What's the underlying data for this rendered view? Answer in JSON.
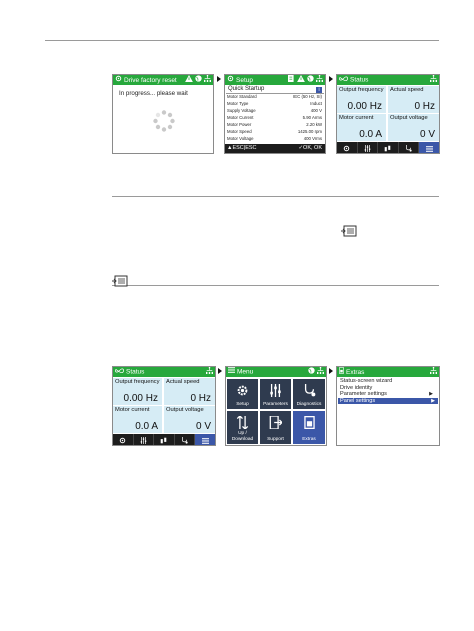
{
  "colors": {
    "title_green": "#27a83c",
    "status_cell": "#d6ecf5",
    "highlight_blue": "#3b57a8",
    "tile_dark": "#2f3b4f",
    "bar_black": "#1d1d1d"
  },
  "screen_factory_reset": {
    "title": "Drive factory reset",
    "title_icons": [
      "gear-icon",
      "warning-icon",
      "globe-icon",
      "network-icon"
    ],
    "message": "In progress... please wait",
    "spinner_icon": "spinner-icon"
  },
  "screen_setup": {
    "title": "Setup",
    "title_icons": [
      "list-icon",
      "warning-icon",
      "globe-icon",
      "network-icon"
    ],
    "header": "Quick Startup",
    "header_badge": "i",
    "rows": [
      {
        "label": "Motor Standard",
        "value": "IEC (50 Hz, SI)"
      },
      {
        "label": "Motor Type",
        "value": "Induct"
      },
      {
        "label": "Supply Voltage",
        "value": "400 V"
      },
      {
        "label": "Motor Current",
        "value": "5.90 Arms"
      },
      {
        "label": "Motor Power",
        "value": "2.20 kW"
      },
      {
        "label": "Motor Speed",
        "value": "1425.00 rpm"
      },
      {
        "label": "Motor Voltage",
        "value": "400 Vrms"
      }
    ],
    "softkey_left": "ESC|ESC",
    "softkey_right": "OK, OK"
  },
  "screen_status_1": {
    "title": "Status",
    "cells": [
      {
        "label": "Output frequency",
        "value": "0.00 Hz"
      },
      {
        "label": "Actual speed",
        "value": "0 Hz"
      },
      {
        "label": "Motor current",
        "value": "0.0 A"
      },
      {
        "label": "Output voltage",
        "value": "0 V"
      }
    ],
    "nav": [
      "gear-icon",
      "sliders-icon",
      "handshake-icon",
      "stethoscope-icon",
      "menu-icon"
    ]
  },
  "screen_status_2": {
    "title": "Status",
    "cells": [
      {
        "label": "Output frequency",
        "value": "0.00 Hz"
      },
      {
        "label": "Actual speed",
        "value": "0 Hz"
      },
      {
        "label": "Motor current",
        "value": "0.0 A"
      },
      {
        "label": "Output voltage",
        "value": "0 V"
      }
    ],
    "nav": [
      "gear-icon",
      "sliders-icon",
      "handshake-icon",
      "stethoscope-icon",
      "menu-icon"
    ]
  },
  "screen_menu": {
    "title": "Menu",
    "tiles": [
      {
        "label": "Setup",
        "icon": "gear-icon"
      },
      {
        "label": "Parameters",
        "icon": "sliders-icon"
      },
      {
        "label": "Diagnostics",
        "icon": "stethoscope-icon"
      },
      {
        "label": "Up / Download",
        "icon": "transfer-icon"
      },
      {
        "label": "Support",
        "icon": "exit-icon"
      },
      {
        "label": "Extras",
        "icon": "extras-icon"
      }
    ]
  },
  "screen_extras": {
    "title": "Extras",
    "items": [
      {
        "label": "Status-screen wizard",
        "has_submenu": false
      },
      {
        "label": "Drive identity",
        "has_submenu": false
      },
      {
        "label": "Parameter settings",
        "has_submenu": true
      },
      {
        "label": "Panel settings",
        "has_submenu": true,
        "selected": true
      }
    ]
  },
  "note_icons": [
    "note-icon",
    "note-icon"
  ]
}
